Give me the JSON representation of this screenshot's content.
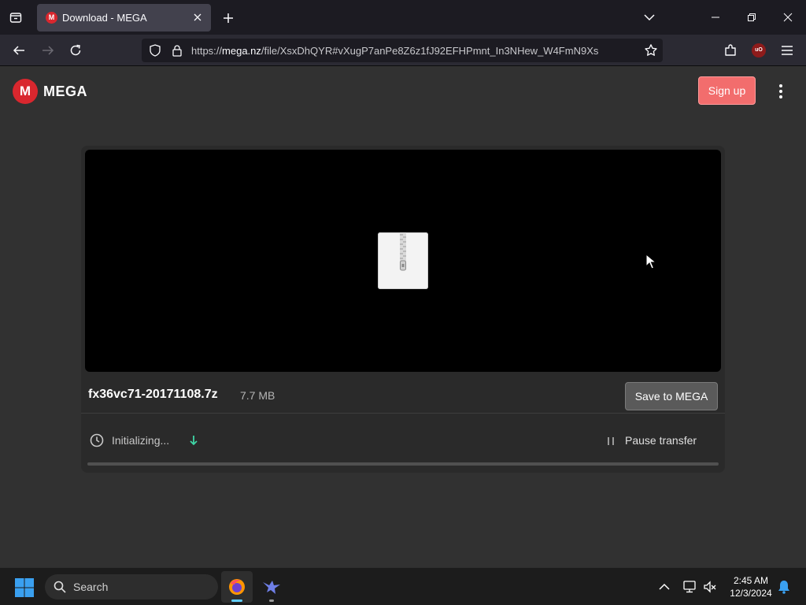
{
  "browser": {
    "tab_title": "Download - MEGA",
    "favicon_letter": "M",
    "url_scheme": "https://",
    "url_host": "mega.nz",
    "url_path": "/file/XsxDhQYR#vXugP7anPe8Z6z1fJ92EFHPmnt_In3NHew_W4FmN9Xs",
    "ublock_label": "uO",
    "icons": [
      "tab-list-icon",
      "close-icon",
      "plus-icon",
      "chevron-down-icon",
      "minimize-icon",
      "restore-icon",
      "back-icon",
      "forward-icon",
      "reload-icon",
      "shield-icon",
      "lock-icon",
      "star-icon",
      "extensions-icon",
      "hamburger-icon"
    ]
  },
  "mega": {
    "logo_mark": "M",
    "logo_text": "MEGA",
    "signup_label": "Sign up",
    "file": {
      "name": "fx36vc71-20171108.7z",
      "size": "7.7 MB",
      "icon": "zip-archive-icon"
    },
    "save_label": "Save to MEGA",
    "transfer": {
      "status": "Initializing...",
      "pause_label": "Pause transfer",
      "progress_fraction": 0
    },
    "colors": {
      "brand_red": "#d9272e",
      "signup_bg": "#f26d6d",
      "arrow_accent": "#3fd6a6"
    }
  },
  "taskbar": {
    "search_placeholder": "Search",
    "time": "2:45 AM",
    "date": "12/3/2024",
    "apps": [
      "firefox-icon",
      "bird-app-icon"
    ]
  }
}
